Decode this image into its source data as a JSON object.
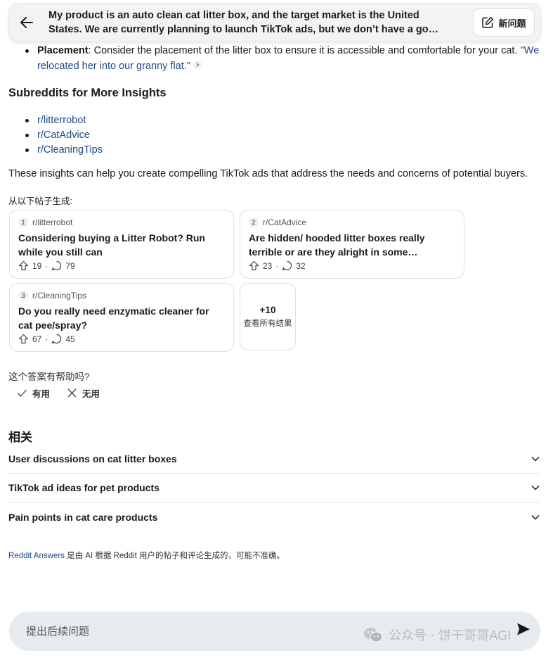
{
  "header": {
    "title_line1": "My product is an auto clean cat litter box, and the target market is the United",
    "title_line2": "States. We are currently planning to launch TikTok ads, but we don’t have a good…",
    "new_question_label": "新问题"
  },
  "placement": {
    "label": "Placement",
    "text": ": Consider the placement of the litter box to ensure it is accessible and comfortable for your cat. ",
    "quote_line1": "\"We",
    "quote_line2": "relocated her into our granny flat.\""
  },
  "subreddits": {
    "heading": "Subreddits for More Insights",
    "items": [
      "r/litterrobot",
      "r/CatAdvice",
      "r/CleaningTips"
    ]
  },
  "insight_text": "These insights can help you create compelling TikTok ads that address the needs and concerns of potential buyers.",
  "generated_from_label": "从以下帖子生成:",
  "sources": [
    {
      "num": "1",
      "subreddit": "r/litterrobot",
      "title": "Considering buying a Litter Robot? Run while you still can",
      "upvotes": "19",
      "comments": "79"
    },
    {
      "num": "2",
      "subreddit": "r/CatAdvice",
      "title": "Are hidden/ hooded litter boxes really terrible or are they alright in some circumstances if...",
      "upvotes": "23",
      "comments": "32"
    },
    {
      "num": "3",
      "subreddit": "r/CleaningTips",
      "title": "Do you really need enzymatic cleaner for cat pee/spray?",
      "upvotes": "67",
      "comments": "45"
    }
  ],
  "more_results": {
    "count": "+10",
    "label": "查看所有结果"
  },
  "feedback": {
    "question": "这个答案有帮助吗?",
    "yes": "有用",
    "no": "无用"
  },
  "related": {
    "heading": "相关",
    "items": [
      "User discussions on cat litter boxes",
      "TikTok ad ideas for pet products",
      "Pain points in cat care products"
    ]
  },
  "footnote": {
    "link": "Reddit Answers",
    "text": " 是由 AI 根据 Reddit 用户的帖子和评论生成的，可能不准确。"
  },
  "followup": {
    "placeholder": "提出后续问题"
  },
  "watermark": "公众号 · 饼干哥哥AGI"
}
